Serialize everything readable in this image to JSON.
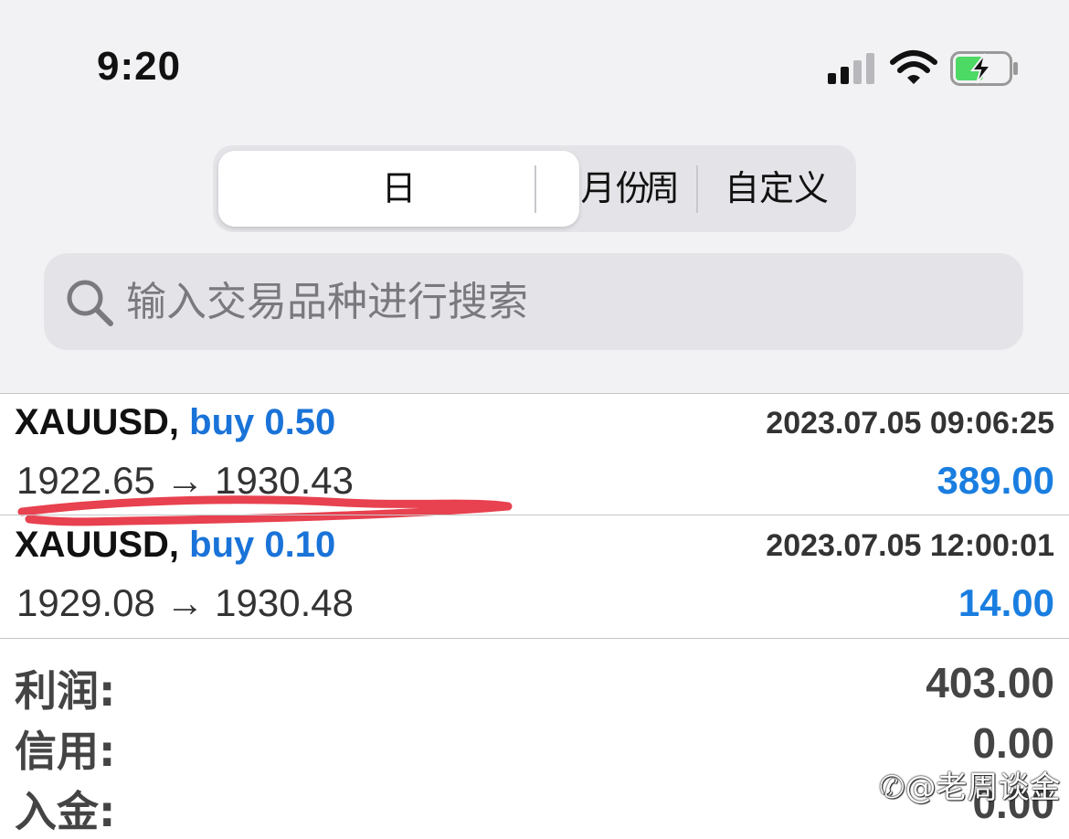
{
  "status_bar": {
    "time": "9:20"
  },
  "period_tabs": [
    {
      "label": "日",
      "selected": true
    },
    {
      "label": "周",
      "selected": false
    },
    {
      "label": "月份",
      "selected": false
    },
    {
      "label": "自定义",
      "selected": false
    }
  ],
  "search": {
    "placeholder": "输入交易品种进行搜索",
    "icon": "search-icon"
  },
  "trades": [
    {
      "symbol": "XAUUSD,",
      "side": "buy 0.50",
      "time": "2023.07.05 09:06:25",
      "prices": "1922.65 → 1930.43",
      "profit": "389.00"
    },
    {
      "symbol": "XAUUSD,",
      "side": "buy 0.10",
      "time": "2023.07.05 12:00:01",
      "prices": "1929.08 → 1930.48",
      "profit": "14.00"
    }
  ],
  "summary": [
    {
      "label": "利润:",
      "value": "403.00"
    },
    {
      "label": "信用:",
      "value": "0.00"
    },
    {
      "label": "入金:",
      "value": "0.00"
    }
  ],
  "watermark": "@老周谈金",
  "colors": {
    "accent_blue": "#1a73d8",
    "underline_red": "#e8414f",
    "background_gray": "#f2f2f4"
  }
}
